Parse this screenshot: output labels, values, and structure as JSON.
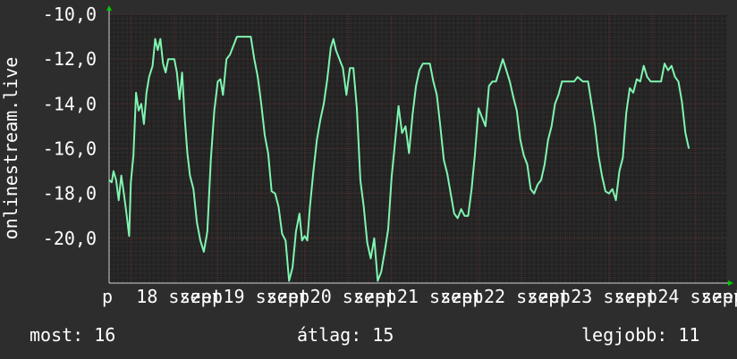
{
  "chart_data": {
    "type": "line",
    "ylabel": "onlinestream.live",
    "ylim": [
      -22,
      -10
    ],
    "yticks": [
      {
        "value": -10,
        "label": "-10,0"
      },
      {
        "value": -12,
        "label": "-12,0"
      },
      {
        "value": -14,
        "label": "-14,0"
      },
      {
        "value": -16,
        "label": "-16,0"
      },
      {
        "value": -18,
        "label": "-18,0"
      },
      {
        "value": -20,
        "label": "-20,0"
      }
    ],
    "xlim": [
      17.75,
      24.85
    ],
    "xticks": [
      {
        "value": 17.75,
        "label": "p"
      },
      {
        "value": 18,
        "label": "18 szept"
      },
      {
        "value": 18.5,
        "label": "szep"
      },
      {
        "value": 19,
        "label": "19 szept"
      },
      {
        "value": 19.5,
        "label": "szep"
      },
      {
        "value": 20,
        "label": "20 szept"
      },
      {
        "value": 20.5,
        "label": "szep"
      },
      {
        "value": 21,
        "label": "21 szept"
      },
      {
        "value": 21.5,
        "label": "szep"
      },
      {
        "value": 22,
        "label": "22 szept"
      },
      {
        "value": 22.5,
        "label": "szep"
      },
      {
        "value": 23,
        "label": "23 szept"
      },
      {
        "value": 23.5,
        "label": "szep"
      },
      {
        "value": 24,
        "label": "24 szept"
      },
      {
        "value": 24.5,
        "label": "szep"
      }
    ],
    "grid": true,
    "colors": {
      "background": "#2d2d2d",
      "plot_background": "#222222",
      "grid_major": "#5a3030",
      "grid_minor": "#3a3434",
      "line": "#7ff5b0",
      "axis_arrow": "#00cc00",
      "text": "#ffffff"
    },
    "series": [
      {
        "values": [
          [
            17.75,
            -17.4
          ],
          [
            17.78,
            -17.5
          ],
          [
            17.8,
            -17.0
          ],
          [
            17.83,
            -17.4
          ],
          [
            17.86,
            -18.3
          ],
          [
            17.89,
            -17.2
          ],
          [
            17.92,
            -18.0
          ],
          [
            17.95,
            -18.9
          ],
          [
            17.98,
            -19.9
          ],
          [
            18.0,
            -17.5
          ],
          [
            18.03,
            -16.3
          ],
          [
            18.06,
            -13.5
          ],
          [
            18.09,
            -14.3
          ],
          [
            18.12,
            -14.0
          ],
          [
            18.15,
            -14.9
          ],
          [
            18.18,
            -13.5
          ],
          [
            18.21,
            -12.8
          ],
          [
            18.25,
            -12.3
          ],
          [
            18.28,
            -11.1
          ],
          [
            18.31,
            -11.6
          ],
          [
            18.34,
            -11.1
          ],
          [
            18.37,
            -12.2
          ],
          [
            18.4,
            -12.6
          ],
          [
            18.43,
            -12.0
          ],
          [
            18.5,
            -12.0
          ],
          [
            18.53,
            -12.6
          ],
          [
            18.56,
            -13.8
          ],
          [
            18.59,
            -12.6
          ],
          [
            18.62,
            -14.6
          ],
          [
            18.65,
            -16.2
          ],
          [
            18.68,
            -17.2
          ],
          [
            18.72,
            -17.8
          ],
          [
            18.76,
            -19.3
          ],
          [
            18.8,
            -20.1
          ],
          [
            18.84,
            -20.6
          ],
          [
            18.88,
            -19.7
          ],
          [
            18.92,
            -16.5
          ],
          [
            18.96,
            -14.3
          ],
          [
            19.0,
            -13.0
          ],
          [
            19.03,
            -12.9
          ],
          [
            19.06,
            -13.6
          ],
          [
            19.1,
            -12.0
          ],
          [
            19.14,
            -11.8
          ],
          [
            19.18,
            -11.4
          ],
          [
            19.22,
            -11.0
          ],
          [
            19.38,
            -11.0
          ],
          [
            19.42,
            -12.0
          ],
          [
            19.46,
            -12.8
          ],
          [
            19.5,
            -14.0
          ],
          [
            19.54,
            -15.4
          ],
          [
            19.58,
            -16.2
          ],
          [
            19.62,
            -17.9
          ],
          [
            19.66,
            -18.0
          ],
          [
            19.7,
            -18.6
          ],
          [
            19.74,
            -19.8
          ],
          [
            19.78,
            -20.1
          ],
          [
            19.82,
            -21.9
          ],
          [
            19.86,
            -21.3
          ],
          [
            19.9,
            -19.7
          ],
          [
            19.94,
            -18.9
          ],
          [
            19.97,
            -20.1
          ],
          [
            20.0,
            -19.9
          ],
          [
            20.03,
            -20.1
          ],
          [
            20.06,
            -18.6
          ],
          [
            20.1,
            -17.0
          ],
          [
            20.14,
            -15.6
          ],
          [
            20.18,
            -14.7
          ],
          [
            20.22,
            -14.0
          ],
          [
            20.26,
            -12.9
          ],
          [
            20.3,
            -11.5
          ],
          [
            20.33,
            -11.1
          ],
          [
            20.36,
            -11.6
          ],
          [
            20.4,
            -12.0
          ],
          [
            20.44,
            -12.4
          ],
          [
            20.48,
            -13.6
          ],
          [
            20.52,
            -12.4
          ],
          [
            20.56,
            -12.4
          ],
          [
            20.6,
            -14.2
          ],
          [
            20.64,
            -17.4
          ],
          [
            20.68,
            -18.6
          ],
          [
            20.72,
            -20.2
          ],
          [
            20.76,
            -20.9
          ],
          [
            20.8,
            -20.0
          ],
          [
            20.84,
            -21.9
          ],
          [
            20.88,
            -21.5
          ],
          [
            20.92,
            -20.6
          ],
          [
            20.96,
            -19.6
          ],
          [
            21.0,
            -17.3
          ],
          [
            21.04,
            -15.7
          ],
          [
            21.08,
            -14.1
          ],
          [
            21.12,
            -15.3
          ],
          [
            21.16,
            -15.0
          ],
          [
            21.2,
            -16.2
          ],
          [
            21.24,
            -14.5
          ],
          [
            21.28,
            -13.2
          ],
          [
            21.32,
            -12.5
          ],
          [
            21.36,
            -12.2
          ],
          [
            21.44,
            -12.2
          ],
          [
            21.48,
            -13.0
          ],
          [
            21.52,
            -13.6
          ],
          [
            21.56,
            -15.0
          ],
          [
            21.6,
            -16.5
          ],
          [
            21.64,
            -17.1
          ],
          [
            21.68,
            -18.0
          ],
          [
            21.72,
            -18.9
          ],
          [
            21.76,
            -19.1
          ],
          [
            21.8,
            -18.7
          ],
          [
            21.84,
            -19.0
          ],
          [
            21.88,
            -19.0
          ],
          [
            21.92,
            -17.8
          ],
          [
            21.96,
            -16.2
          ],
          [
            22.0,
            -14.2
          ],
          [
            22.04,
            -14.6
          ],
          [
            22.08,
            -15.0
          ],
          [
            22.12,
            -13.2
          ],
          [
            22.16,
            -13.0
          ],
          [
            22.2,
            -13.0
          ],
          [
            22.24,
            -12.5
          ],
          [
            22.28,
            -12.0
          ],
          [
            22.32,
            -12.5
          ],
          [
            22.36,
            -13.0
          ],
          [
            22.4,
            -13.7
          ],
          [
            22.44,
            -14.3
          ],
          [
            22.48,
            -15.6
          ],
          [
            22.52,
            -16.3
          ],
          [
            22.56,
            -16.7
          ],
          [
            22.6,
            -17.8
          ],
          [
            22.64,
            -18.0
          ],
          [
            22.68,
            -17.6
          ],
          [
            22.72,
            -17.4
          ],
          [
            22.76,
            -16.7
          ],
          [
            22.8,
            -15.6
          ],
          [
            22.84,
            -15.0
          ],
          [
            22.88,
            -14.0
          ],
          [
            22.92,
            -13.6
          ],
          [
            22.96,
            -13.0
          ],
          [
            23.06,
            -13.0
          ],
          [
            23.1,
            -13.0
          ],
          [
            23.14,
            -12.8
          ],
          [
            23.2,
            -13.0
          ],
          [
            23.26,
            -13.0
          ],
          [
            23.3,
            -14.0
          ],
          [
            23.34,
            -15.0
          ],
          [
            23.38,
            -16.3
          ],
          [
            23.42,
            -17.2
          ],
          [
            23.46,
            -17.9
          ],
          [
            23.5,
            -18.0
          ],
          [
            23.54,
            -17.8
          ],
          [
            23.58,
            -18.3
          ],
          [
            23.62,
            -17.0
          ],
          [
            23.66,
            -16.4
          ],
          [
            23.7,
            -14.4
          ],
          [
            23.74,
            -13.3
          ],
          [
            23.78,
            -13.5
          ],
          [
            23.82,
            -12.9
          ],
          [
            23.86,
            -13.0
          ],
          [
            23.9,
            -12.3
          ],
          [
            23.94,
            -12.8
          ],
          [
            23.98,
            -13.0
          ],
          [
            24.0,
            -13.0
          ],
          [
            24.1,
            -13.0
          ],
          [
            24.14,
            -12.2
          ],
          [
            24.18,
            -12.5
          ],
          [
            24.22,
            -12.3
          ],
          [
            24.26,
            -12.8
          ],
          [
            24.3,
            -13.0
          ],
          [
            24.34,
            -13.9
          ],
          [
            24.38,
            -15.3
          ],
          [
            24.42,
            -16.0
          ]
        ]
      }
    ],
    "footer": {
      "now": "most: 16",
      "avg": "átlag: 15",
      "best": "legjobb: 11"
    }
  }
}
